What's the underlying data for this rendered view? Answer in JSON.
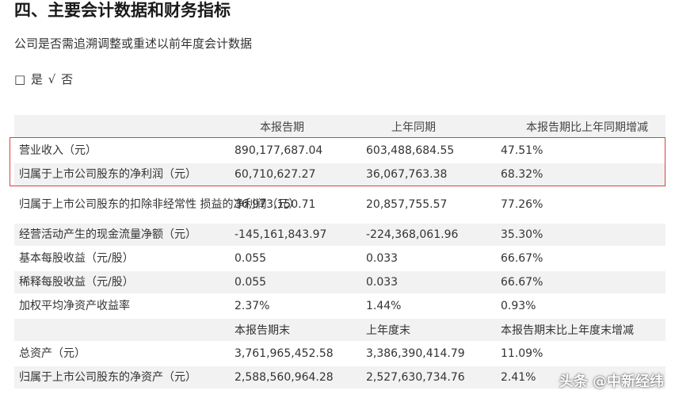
{
  "heading": "四、主要会计数据和财务指标",
  "subtitle": "公司是否需追溯调整或重述以前年度会计数据",
  "choice": {
    "box": "□",
    "yes": "是",
    "check": "√",
    "no": "否"
  },
  "table": {
    "header1": [
      "",
      "本报告期",
      "上年同期",
      "本报告期比上年同期增减"
    ],
    "rows1": [
      [
        "营业收入（元）",
        "890,177,687.04",
        "603,488,684.55",
        "47.51%"
      ],
      [
        "归属于上市公司股东的净利润（元）",
        "60,710,627.27",
        "36,067,763.38",
        "68.32%"
      ],
      [
        "归属于上市公司股东的扣除非经常性 损益的净利润（元）",
        "36,973,150.71",
        "20,857,755.57",
        "77.26%"
      ],
      [
        "经营活动产生的现金流量净额（元）",
        "-145,161,843.97",
        "-224,368,061.96",
        "35.30%"
      ],
      [
        "基本每股收益（元/股）",
        "0.055",
        "0.033",
        "66.67%"
      ],
      [
        "稀释每股收益（元/股）",
        "0.055",
        "0.033",
        "66.67%"
      ],
      [
        "加权平均净资产收益率",
        "2.37%",
        "1.44%",
        "0.93%"
      ]
    ],
    "header2": [
      "",
      "本报告期末",
      "上年度末",
      "本报告期末比上年度末增减"
    ],
    "rows2": [
      [
        "总资产（元）",
        "3,761,965,452.58",
        "3,386,390,414.79",
        "11.09%"
      ],
      [
        "归属于上市公司股东的净资产（元）",
        "2,588,560,964.28",
        "2,527,630,734.76",
        "2.41%"
      ]
    ]
  },
  "watermark": "头条 @中新经纬"
}
